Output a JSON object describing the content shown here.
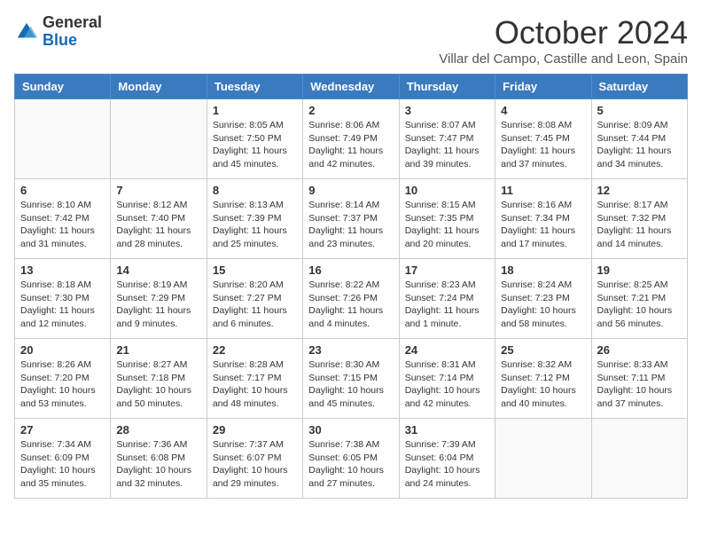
{
  "header": {
    "logo_general": "General",
    "logo_blue": "Blue",
    "month_title": "October 2024",
    "subtitle": "Villar del Campo, Castille and Leon, Spain"
  },
  "weekdays": [
    "Sunday",
    "Monday",
    "Tuesday",
    "Wednesday",
    "Thursday",
    "Friday",
    "Saturday"
  ],
  "weeks": [
    [
      {
        "day": "",
        "info": ""
      },
      {
        "day": "",
        "info": ""
      },
      {
        "day": "1",
        "info": "Sunrise: 8:05 AM\nSunset: 7:50 PM\nDaylight: 11 hours and 45 minutes."
      },
      {
        "day": "2",
        "info": "Sunrise: 8:06 AM\nSunset: 7:49 PM\nDaylight: 11 hours and 42 minutes."
      },
      {
        "day": "3",
        "info": "Sunrise: 8:07 AM\nSunset: 7:47 PM\nDaylight: 11 hours and 39 minutes."
      },
      {
        "day": "4",
        "info": "Sunrise: 8:08 AM\nSunset: 7:45 PM\nDaylight: 11 hours and 37 minutes."
      },
      {
        "day": "5",
        "info": "Sunrise: 8:09 AM\nSunset: 7:44 PM\nDaylight: 11 hours and 34 minutes."
      }
    ],
    [
      {
        "day": "6",
        "info": "Sunrise: 8:10 AM\nSunset: 7:42 PM\nDaylight: 11 hours and 31 minutes."
      },
      {
        "day": "7",
        "info": "Sunrise: 8:12 AM\nSunset: 7:40 PM\nDaylight: 11 hours and 28 minutes."
      },
      {
        "day": "8",
        "info": "Sunrise: 8:13 AM\nSunset: 7:39 PM\nDaylight: 11 hours and 25 minutes."
      },
      {
        "day": "9",
        "info": "Sunrise: 8:14 AM\nSunset: 7:37 PM\nDaylight: 11 hours and 23 minutes."
      },
      {
        "day": "10",
        "info": "Sunrise: 8:15 AM\nSunset: 7:35 PM\nDaylight: 11 hours and 20 minutes."
      },
      {
        "day": "11",
        "info": "Sunrise: 8:16 AM\nSunset: 7:34 PM\nDaylight: 11 hours and 17 minutes."
      },
      {
        "day": "12",
        "info": "Sunrise: 8:17 AM\nSunset: 7:32 PM\nDaylight: 11 hours and 14 minutes."
      }
    ],
    [
      {
        "day": "13",
        "info": "Sunrise: 8:18 AM\nSunset: 7:30 PM\nDaylight: 11 hours and 12 minutes."
      },
      {
        "day": "14",
        "info": "Sunrise: 8:19 AM\nSunset: 7:29 PM\nDaylight: 11 hours and 9 minutes."
      },
      {
        "day": "15",
        "info": "Sunrise: 8:20 AM\nSunset: 7:27 PM\nDaylight: 11 hours and 6 minutes."
      },
      {
        "day": "16",
        "info": "Sunrise: 8:22 AM\nSunset: 7:26 PM\nDaylight: 11 hours and 4 minutes."
      },
      {
        "day": "17",
        "info": "Sunrise: 8:23 AM\nSunset: 7:24 PM\nDaylight: 11 hours and 1 minute."
      },
      {
        "day": "18",
        "info": "Sunrise: 8:24 AM\nSunset: 7:23 PM\nDaylight: 10 hours and 58 minutes."
      },
      {
        "day": "19",
        "info": "Sunrise: 8:25 AM\nSunset: 7:21 PM\nDaylight: 10 hours and 56 minutes."
      }
    ],
    [
      {
        "day": "20",
        "info": "Sunrise: 8:26 AM\nSunset: 7:20 PM\nDaylight: 10 hours and 53 minutes."
      },
      {
        "day": "21",
        "info": "Sunrise: 8:27 AM\nSunset: 7:18 PM\nDaylight: 10 hours and 50 minutes."
      },
      {
        "day": "22",
        "info": "Sunrise: 8:28 AM\nSunset: 7:17 PM\nDaylight: 10 hours and 48 minutes."
      },
      {
        "day": "23",
        "info": "Sunrise: 8:30 AM\nSunset: 7:15 PM\nDaylight: 10 hours and 45 minutes."
      },
      {
        "day": "24",
        "info": "Sunrise: 8:31 AM\nSunset: 7:14 PM\nDaylight: 10 hours and 42 minutes."
      },
      {
        "day": "25",
        "info": "Sunrise: 8:32 AM\nSunset: 7:12 PM\nDaylight: 10 hours and 40 minutes."
      },
      {
        "day": "26",
        "info": "Sunrise: 8:33 AM\nSunset: 7:11 PM\nDaylight: 10 hours and 37 minutes."
      }
    ],
    [
      {
        "day": "27",
        "info": "Sunrise: 7:34 AM\nSunset: 6:09 PM\nDaylight: 10 hours and 35 minutes."
      },
      {
        "day": "28",
        "info": "Sunrise: 7:36 AM\nSunset: 6:08 PM\nDaylight: 10 hours and 32 minutes."
      },
      {
        "day": "29",
        "info": "Sunrise: 7:37 AM\nSunset: 6:07 PM\nDaylight: 10 hours and 29 minutes."
      },
      {
        "day": "30",
        "info": "Sunrise: 7:38 AM\nSunset: 6:05 PM\nDaylight: 10 hours and 27 minutes."
      },
      {
        "day": "31",
        "info": "Sunrise: 7:39 AM\nSunset: 6:04 PM\nDaylight: 10 hours and 24 minutes."
      },
      {
        "day": "",
        "info": ""
      },
      {
        "day": "",
        "info": ""
      }
    ]
  ]
}
